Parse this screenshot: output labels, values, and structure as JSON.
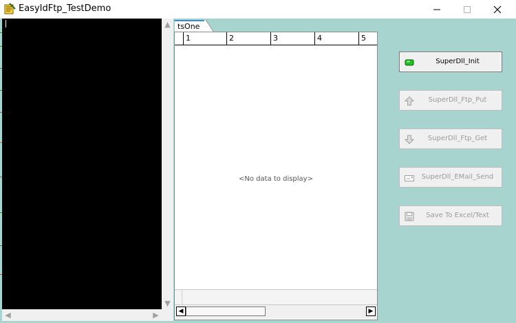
{
  "window": {
    "title": "EasyIdFtp_TestDemo",
    "controls": {
      "minimize": "—",
      "maximize": "☐",
      "close": "✕"
    }
  },
  "grid": {
    "tab_label": "tsOne",
    "columns": [
      "1",
      "2",
      "3",
      "4",
      "5"
    ],
    "empty_text": "<No data to display>"
  },
  "buttons": [
    {
      "label": "SuperDll_Init",
      "icon": "green-led-icon",
      "enabled": true
    },
    {
      "label": "SuperDll_Ftp_Put",
      "icon": "upload-arrow-icon",
      "enabled": false
    },
    {
      "label": "SuperDll_Ftp_Get",
      "icon": "download-arrow-icon",
      "enabled": false
    },
    {
      "label": "SuperDll_EMail_Send",
      "icon": "email-icon",
      "enabled": false
    },
    {
      "label": "Save To Excel/Text",
      "icon": "floppy-disk-icon",
      "enabled": false
    }
  ],
  "colors": {
    "client_bg": "#a8d4d0",
    "memo_bg": "#000000",
    "tab_accent": "#3c8ad8",
    "led": "#22c022"
  }
}
